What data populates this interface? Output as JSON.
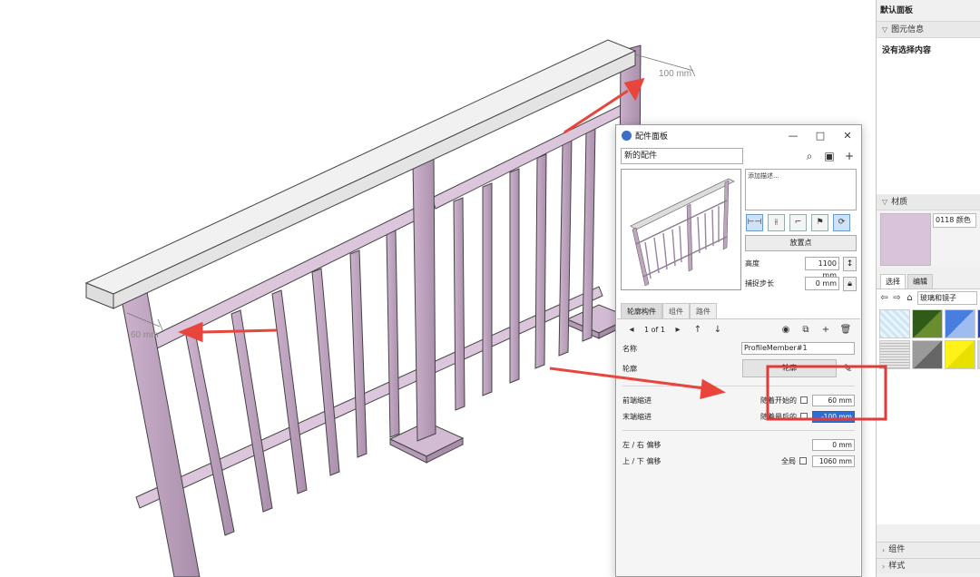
{
  "viewport": {
    "dim_top": "100 mm",
    "dim_left": "60 mm"
  },
  "tray": {
    "title": "默认面板",
    "entity_info": {
      "header": "图元信息",
      "empty_text": "没有选择内容"
    },
    "materials": {
      "header": "材质",
      "current_name": "0118 颜色",
      "tab_select": "选择",
      "tab_edit": "编辑",
      "library": "玻璃和镜子"
    },
    "components_header": "组件",
    "styles_header": "样式"
  },
  "dialog": {
    "title": "配件面板",
    "name_value": "新的配件",
    "description": "添加描述...",
    "place_button": "放置点",
    "height_label": "高度",
    "height_value": "1100 mm",
    "step_label": "捕捉步长",
    "step_value": "0 mm",
    "tabs": [
      "轮廓构件",
      "组件",
      "路件"
    ],
    "pager": "1 of 1",
    "name_label": "名称",
    "name_field": "ProfileMember#1",
    "profile_label": "轮廓",
    "profile_button": "轮廓",
    "front_offset_label": "前端缩进",
    "back_offset_label": "末端缩进",
    "start_label": "随着开始的",
    "end_label": "随着最后的",
    "start_value": "60 mm",
    "end_value": "-100 mm",
    "lr_offset_label": "左 / 右 偏移",
    "lr_offset_value": "0 mm",
    "ud_offset_label": "上 / 下 偏移",
    "global_label": "全局",
    "ud_offset_value": "1060 mm"
  },
  "colors": {
    "railing": "#d9c0d9",
    "railing_edge": "#3a3a3a",
    "handrail": "#e6e6e6",
    "arrow": "#e8453c",
    "highlight_box": "#e03a3a"
  }
}
